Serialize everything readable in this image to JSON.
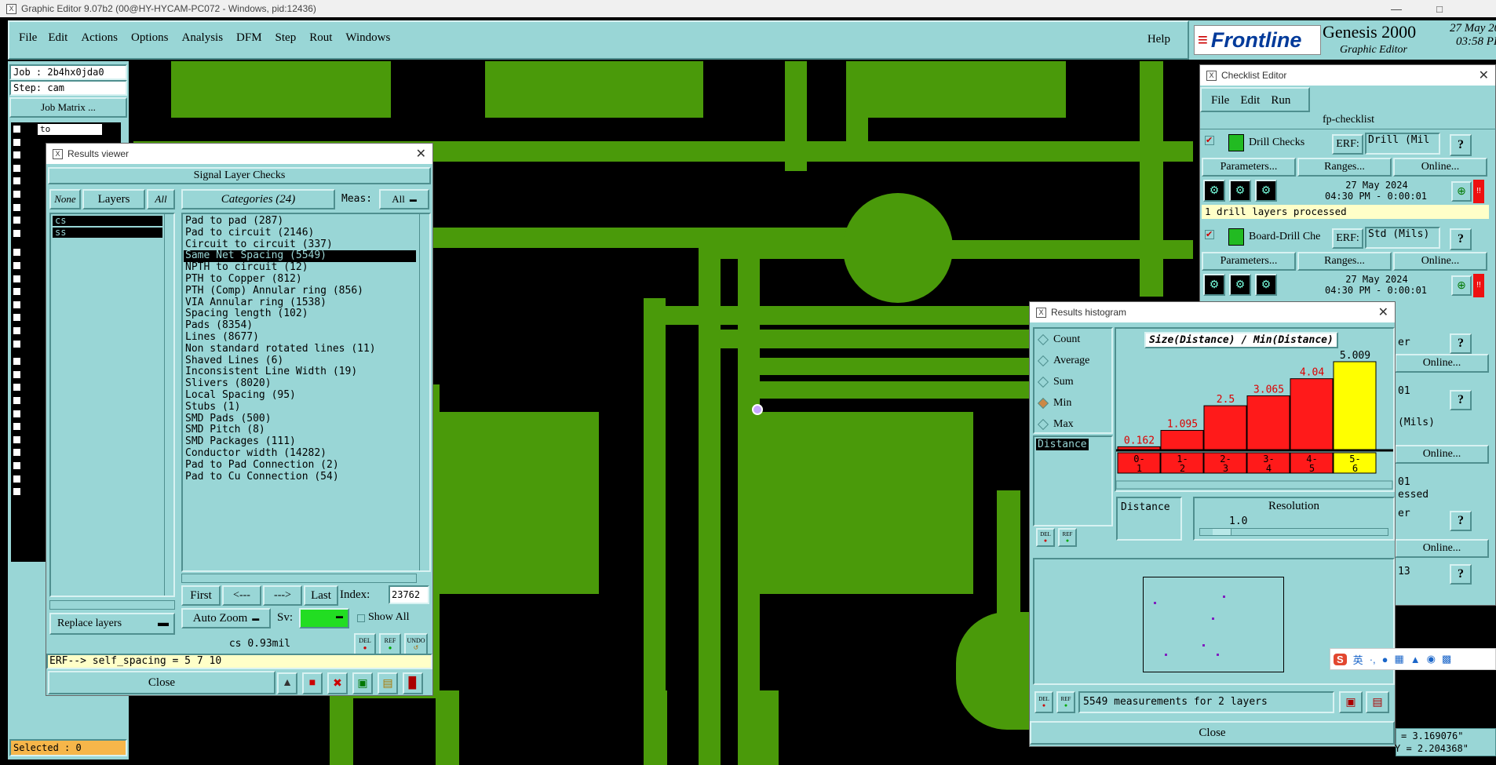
{
  "title_bar": {
    "text": "Graphic Editor 9.07b2 (00@HY-HYCAM-PC072 - Windows, pid:12436)"
  },
  "menu": {
    "items": [
      "File",
      "Edit",
      "Actions",
      "Options",
      "Analysis",
      "DFM",
      "Step",
      "Rout",
      "Windows"
    ],
    "help": "Help"
  },
  "brand": {
    "logo": "Frontline",
    "product": "Genesis 2000",
    "sub": "Graphic Editor",
    "date": "27 May 20",
    "time": "03:58 PI"
  },
  "job": {
    "job": "Job : 2b4hx0jda0",
    "step": "Step: cam",
    "matrix": "Job Matrix ..."
  },
  "layer_rows": {
    "first": "to"
  },
  "selected": "Selected : 0",
  "coords": {
    "x": "= 3.169076\"",
    "y": "Y = 2.204368\""
  },
  "results_viewer": {
    "title": "Results viewer",
    "heading": "Signal Layer Checks",
    "none_btn": "None",
    "layers_btn": "Layers",
    "all_btn": "All",
    "layers": [
      "cs",
      "ss"
    ],
    "categories_btn": "Categories (24)",
    "meas_label": "Meas:",
    "meas_value": "All",
    "categories": [
      "Pad to pad (287)",
      "Pad to circuit (2146)",
      "Circuit to circuit (337)",
      "Same Net Spacing (5549)",
      "NPTH to circuit (12)",
      "PTH to Copper (812)",
      "PTH (Comp) Annular ring (856)",
      "VIA Annular ring (1538)",
      "Spacing length (102)",
      "Pads (8354)",
      "Lines (8677)",
      "Non standard rotated lines (11)",
      "Shaved Lines (6)",
      "Inconsistent Line Width (19)",
      "Slivers (8020)",
      "Local Spacing (95)",
      "Stubs (1)",
      "SMD Pads (500)",
      "SMD Pitch (8)",
      "SMD Packages (111)",
      "Conductor width (14282)",
      "Pad to Pad Connection (2)",
      "Pad to Cu Connection (54)"
    ],
    "selected_category": "Same Net Spacing (5549)",
    "nav": {
      "first": "First",
      "prev": "<---",
      "next": "--->",
      "last": "Last",
      "index_label": "Index:",
      "index_value": "23762"
    },
    "auto_zoom": "Auto Zoom",
    "sv_label": "Sv:",
    "show_all": "Show All",
    "replace_layers": "Replace layers",
    "status": "cs 0.93mil",
    "erf": "ERF--> self_spacing = 5 7 10",
    "close": "Close",
    "del": "DEL",
    "ref": "REF",
    "undo": "UNDO"
  },
  "checklist": {
    "title": "Checklist Editor",
    "menu": [
      "File",
      "Edit",
      "Run"
    ],
    "name": "fp-checklist",
    "items": [
      {
        "name": "Drill Checks",
        "erf_label": "ERF:",
        "erf": "Drill (Mil",
        "params": "Parameters...",
        "ranges": "Ranges...",
        "online": "Online...",
        "date": "27 May 2024",
        "time": "04:30 PM - 0:00:01",
        "msg": "1 drill layers processed"
      },
      {
        "name": "Board-Drill Che",
        "erf_label": "ERF:",
        "erf": "Std (Mils)",
        "params": "Parameters...",
        "ranges": "Ranges...",
        "online": "Online...",
        "date": "27 May 2024",
        "time": "04:30 PM - 0:00:01"
      }
    ],
    "partial": [
      "er",
      "Online...",
      "01",
      "(Mils)",
      "Online...",
      "01",
      "essed",
      "er",
      "Online...",
      "13"
    ]
  },
  "histogram": {
    "title": "Results histogram",
    "options": [
      "Count",
      "Average",
      "Sum",
      "Min",
      "Max"
    ],
    "selected_option": "Min",
    "list_item": "Distance",
    "chart_title": "Size(Distance) / Min(Distance)",
    "resolution_label": "Resolution",
    "resolution_value": "1.0",
    "dist_field": "Distance",
    "measurements": "5549 measurements for 2 layers",
    "close": "Close",
    "del": "DEL",
    "ref": "REF"
  },
  "chart_data": {
    "type": "bar",
    "title": "Size(Distance) / Min(Distance)",
    "categories": [
      "0-1",
      "1-2",
      "2-3",
      "3-4",
      "4-5",
      "5-6"
    ],
    "values": [
      0.162,
      1.095,
      2.5,
      3.065,
      4.04,
      5.009
    ],
    "colors": [
      "#ff1a1a",
      "#ff1a1a",
      "#ff1a1a",
      "#ff1a1a",
      "#ff1a1a",
      "#ffff00"
    ],
    "ylim": [
      0,
      5.2
    ]
  },
  "ime": {
    "label": "英"
  }
}
